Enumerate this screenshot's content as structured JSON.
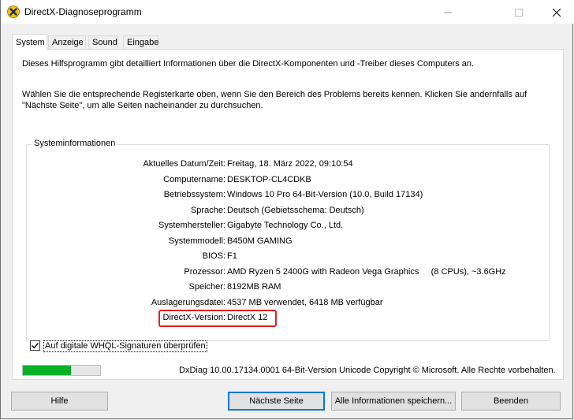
{
  "window": {
    "title": "DirectX-Diagnoseprogramm",
    "icon": "directx-icon",
    "controls": [
      "minimize-icon",
      "maximize-icon",
      "close-icon"
    ]
  },
  "tabs": [
    {
      "label": "System",
      "active": true
    },
    {
      "label": "Anzeige",
      "active": false
    },
    {
      "label": "Sound",
      "active": false
    },
    {
      "label": "Eingabe",
      "active": false
    }
  ],
  "intro": {
    "line1": "Dieses Hilfsprogramm gibt detailliert Informationen über die DirectX-Komponenten und -Treiber dieses Computers an.",
    "line2": "Wählen Sie die entsprechende Registerkarte oben, wenn Sie den Bereich des Problems bereits kennen. Klicken Sie andernfalls auf \"Nächste Seite\", um alle Seiten nacheinander zu durchsuchen."
  },
  "sysinfo": {
    "title": "Systeminformationen",
    "rows": [
      {
        "label": "Aktuelles Datum/Zeit:",
        "value": "Freitag, 18. März 2022, 09:10:54"
      },
      {
        "label": "Computername:",
        "value": "DESKTOP-CL4CDKB"
      },
      {
        "label": "Betriebssystem:",
        "value": "Windows 10 Pro 64-Bit-Version (10.0, Build 17134)"
      },
      {
        "label": "Sprache:",
        "value": "Deutsch (Gebietsschema: Deutsch)"
      },
      {
        "label": "Systemhersteller:",
        "value": "Gigabyte Technology Co., Ltd."
      },
      {
        "label": "Systemmodell:",
        "value": "B450M GAMING"
      },
      {
        "label": "BIOS:",
        "value": "F1"
      },
      {
        "label": "Prozessor:",
        "value": "AMD Ryzen 5 2400G with Radeon Vega Graphics     (8 CPUs), ~3.6GHz"
      },
      {
        "label": "Speicher:",
        "value": "8192MB RAM"
      },
      {
        "label": "Auslagerungsdatei:",
        "value": "4537 MB verwendet, 6418 MB verfügbar"
      },
      {
        "label": "DirectX-Version:",
        "value": "DirectX 12"
      }
    ],
    "highlight_color": "#e02020"
  },
  "whql": {
    "label": "Auf digitale WHQL-Signaturen überprüfen",
    "checked": true
  },
  "progress": {
    "fraction": 0.62,
    "color": "#06b025"
  },
  "footer": {
    "copyright": "DxDiag 10.00.17134.0001 64-Bit-Version Unicode Copyright © Microsoft. Alle Rechte vorbehalten."
  },
  "buttons": {
    "help": "Hilfe",
    "next": "Nächste Seite",
    "save": "Alle Informationen speichern...",
    "exit": "Beenden"
  }
}
